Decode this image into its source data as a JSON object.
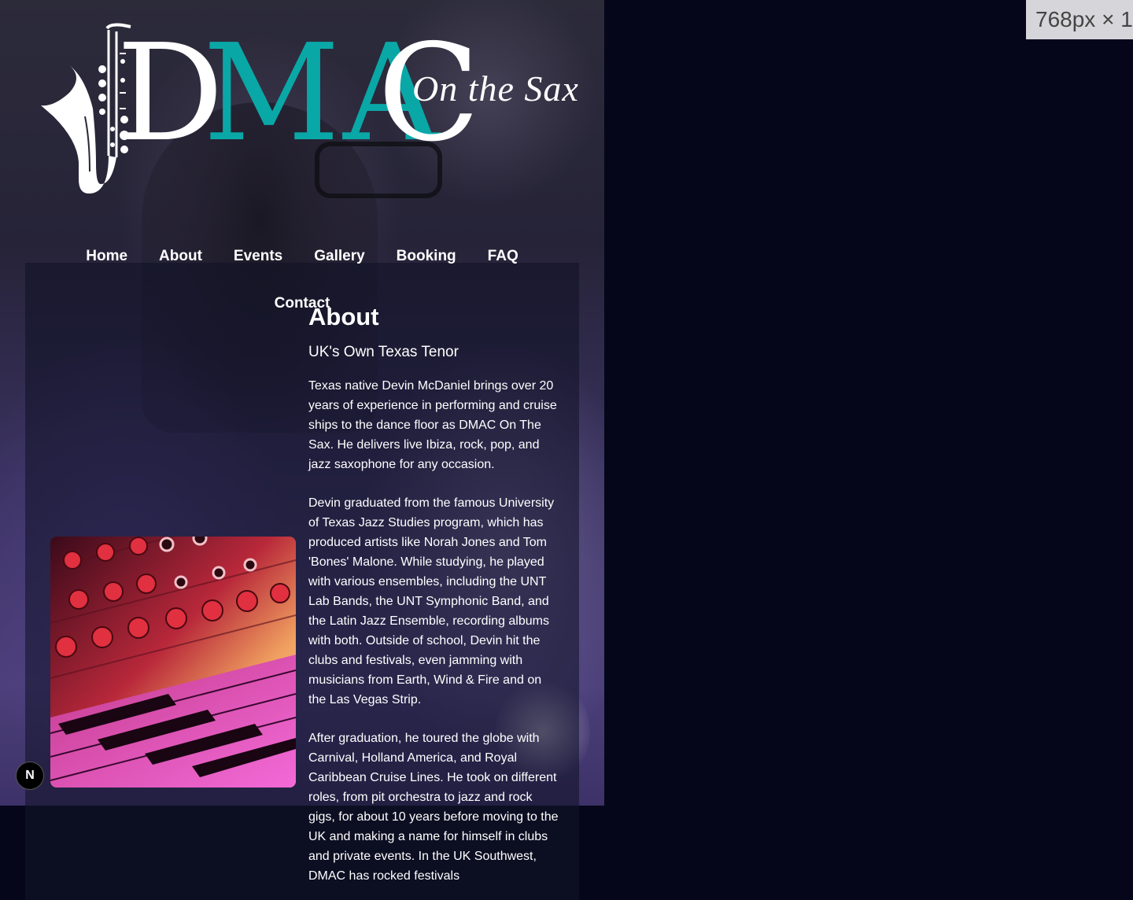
{
  "logo": {
    "d": "D",
    "ma": "MA",
    "c": "C",
    "tagline": "On the Sax"
  },
  "nav": {
    "items": [
      "Home",
      "About",
      "Events",
      "Gallery",
      "Booking",
      "FAQ"
    ],
    "contact": "Contact"
  },
  "about": {
    "heading": "About",
    "subheading": "UK's Own Texas Tenor",
    "paragraphs": [
      "Texas native Devin McDaniel brings over 20 years of experience in performing and cruise ships to the dance floor as DMAC On The Sax. He delivers live Ibiza, rock, pop, and jazz saxophone for any occasion.",
      "Devin graduated from the famous University of Texas Jazz Studies program, which has produced artists like Norah Jones and Tom 'Bones' Malone. While studying, he played with various ensembles, including the UNT Lab Bands, the UNT Symphonic Band, and the Latin Jazz Ensemble, recording albums with both. Outside of school, Devin hit the clubs and festivals, even jamming with musicians from Earth, Wind & Fire and on the Las Vegas Strip.",
      "After graduation, he toured the globe with Carnival, Holland America, and Royal Caribbean Cruise Lines. He took on different roles, from pit orchestra to jazz and rock gigs, for about 10 years before moving to the UK and making a name for himself in clubs and private events. In the UK Southwest, DMAC has rocked festivals"
    ]
  },
  "badges": {
    "n": "N",
    "size": "768px × 1"
  },
  "colors": {
    "accent_teal": "#0aa7a7",
    "page_bg": "#05061a"
  }
}
